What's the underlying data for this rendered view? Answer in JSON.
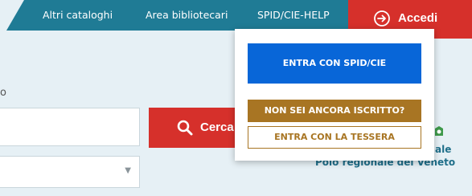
{
  "nav": {
    "links": [
      "Altri cataloghi",
      "Area bibliotecari",
      "SPID/CIE-HELP"
    ],
    "login_label": "Accedi"
  },
  "search": {
    "hint": "o",
    "input_value": "",
    "button_label": "Cerca"
  },
  "filter": {
    "selected": ""
  },
  "brand": {
    "line1": "ale",
    "line2": "Polo regionale del Veneto"
  },
  "login_menu": {
    "spid_label": "ENTRA CON SPID/CIE",
    "register_label": "NON SEI ANCORA ISCRITTO?",
    "card_label": "ENTRA CON LA TESSERA"
  },
  "colors": {
    "nav_bg": "#1f7b95",
    "accent_red": "#d6302b",
    "spid_blue": "#0866d8",
    "gold": "#a87523"
  },
  "icons": {
    "login": "login-arrow-icon",
    "search": "search-icon",
    "select": "chevron-down-icon"
  }
}
